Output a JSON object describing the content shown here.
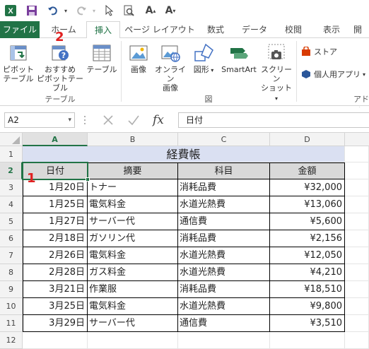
{
  "app": {
    "name": "Excel",
    "accent": "#217346"
  },
  "quick_access": {
    "icons": [
      "excel-app-icon",
      "save-icon",
      "undo-icon",
      "redo-icon",
      "select-pointer-icon",
      "print-preview-icon",
      "increase-font-icon",
      "decrease-font-icon"
    ]
  },
  "tabs": [
    {
      "label": "ファイル"
    },
    {
      "label": "ホーム"
    },
    {
      "label": "挿入"
    },
    {
      "label": "ページ レイアウト"
    },
    {
      "label": "数式"
    },
    {
      "label": "データ"
    },
    {
      "label": "校閲"
    },
    {
      "label": "表示"
    },
    {
      "label": "開"
    }
  ],
  "active_tab": "挿入",
  "ribbon": {
    "pivot": {
      "line1": "ピボット",
      "line2": "テーブル"
    },
    "recommended_pivot": {
      "line1": "おすすめ",
      "line2": "ピボットテーブル"
    },
    "table": {
      "label": "テーブル"
    },
    "picture": {
      "label": "画像"
    },
    "online_picture": {
      "line1": "オンライン",
      "line2": "画像"
    },
    "shapes": {
      "label": "図形"
    },
    "smartart": {
      "label": "SmartArt"
    },
    "screenshot": {
      "line1": "スクリーン",
      "line2": "ショット"
    },
    "store": {
      "label": "ストア"
    },
    "my_apps": {
      "label": "個人用アプリ"
    },
    "group_table": "テーブル",
    "group_illust": "図",
    "group_addin": "アドイ"
  },
  "formula_bar": {
    "name_box": "A2",
    "fx": "fx",
    "content": "日付"
  },
  "columns": [
    "A",
    "B",
    "C",
    "D"
  ],
  "rows": [
    "1",
    "2",
    "3",
    "4",
    "5",
    "6",
    "7",
    "8",
    "9",
    "10",
    "11",
    "12"
  ],
  "sheet": {
    "title": "経費帳",
    "headers": [
      "日付",
      "摘要",
      "科目",
      "金額"
    ],
    "records": [
      [
        "1月20日",
        "トナー",
        "消耗品費",
        "¥32,000"
      ],
      [
        "1月25日",
        "電気料金",
        "水道光熱費",
        "¥13,060"
      ],
      [
        "1月27日",
        "サーバー代",
        "通信費",
        "¥5,600"
      ],
      [
        "2月18日",
        "ガソリン代",
        "消耗品費",
        "¥2,156"
      ],
      [
        "2月26日",
        "電気料金",
        "水道光熱費",
        "¥12,050"
      ],
      [
        "2月28日",
        "ガス料金",
        "水道光熱費",
        "¥4,210"
      ],
      [
        "3月21日",
        "作業服",
        "消耗品費",
        "¥18,510"
      ],
      [
        "3月25日",
        "電気料金",
        "水道光熱費",
        "¥9,800"
      ],
      [
        "3月29日",
        "サーバー代",
        "通信費",
        "¥3,510"
      ]
    ]
  },
  "markers": {
    "one": "1",
    "two": "2"
  }
}
